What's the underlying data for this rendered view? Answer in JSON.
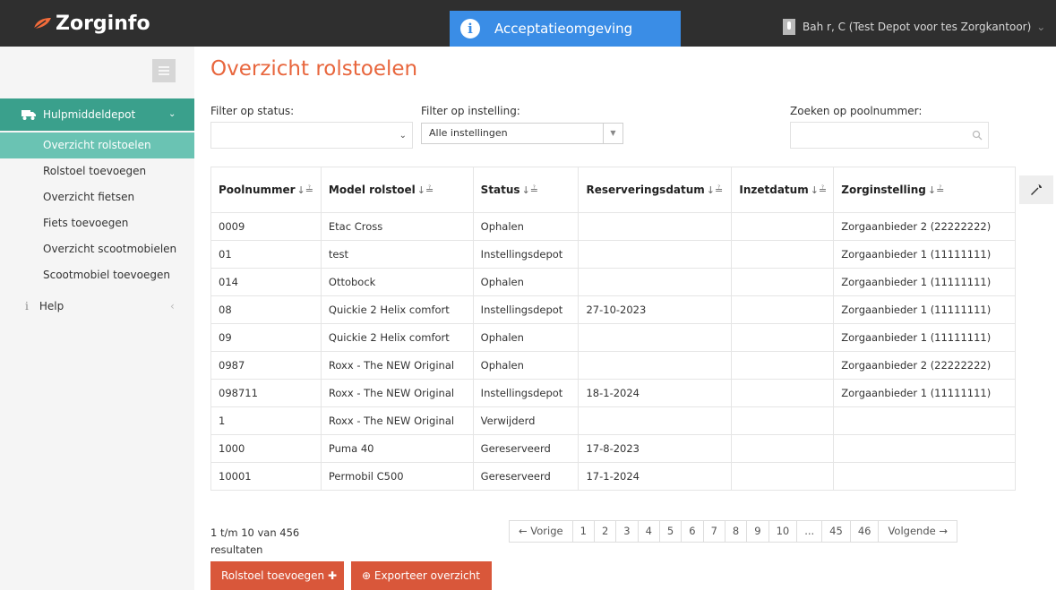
{
  "header": {
    "logo_text": "Zorginfo",
    "environment": "Acceptatieomgeving",
    "environment_icon": "i",
    "user": "Bah r, C (Test Depot voor tes Zorgkantoor)",
    "user_caret": "⌄"
  },
  "colors": {
    "topbar": "#2f2f2f",
    "environment_banner": "#3a8de6",
    "sidebar_section": "#3aa08c",
    "sidebar_active": "#6ac3b3",
    "title": "#e8663d",
    "button": "#d9573a"
  },
  "sidebar": {
    "section_label": "Hulpmiddeldepot",
    "section_icon": "truck-icon",
    "items": [
      {
        "label": "Overzicht rolstoelen",
        "active": true
      },
      {
        "label": "Rolstoel toevoegen"
      },
      {
        "label": "Overzicht fietsen"
      },
      {
        "label": "Fiets toevoegen"
      },
      {
        "label": "Overzicht scootmobielen"
      },
      {
        "label": "Scootmobiel toevoegen"
      }
    ],
    "help_label": "Help"
  },
  "main": {
    "title": "Overzicht rolstoelen",
    "filter_status_label": "Filter op status:",
    "filter_status_value": "",
    "filter_instelling_label": "Filter op instelling:",
    "filter_instelling_value": "Alle instellingen",
    "search_label": "Zoeken op poolnummer:",
    "search_value": ""
  },
  "table": {
    "sort_glyph": "↓≟",
    "columns": [
      "Poolnummer",
      "Model rolstoel",
      "Status",
      "Reserveringsdatum",
      "Inzetdatum",
      "Zorginstelling"
    ],
    "rows": [
      [
        "0009",
        "Etac Cross",
        "Ophalen",
        "",
        "",
        "Zorgaanbieder 2 (22222222)"
      ],
      [
        "01",
        "test",
        "Instellingsdepot",
        "",
        "",
        "Zorgaanbieder 1 (11111111)"
      ],
      [
        "014",
        "Ottobock",
        "Ophalen",
        "",
        "",
        "Zorgaanbieder 1 (11111111)"
      ],
      [
        "08",
        "Quickie 2 Helix comfort",
        "Instellingsdepot",
        "27-10-2023",
        "",
        "Zorgaanbieder 1 (11111111)"
      ],
      [
        "09",
        "Quickie 2 Helix comfort",
        "Ophalen",
        "",
        "",
        "Zorgaanbieder 1 (11111111)"
      ],
      [
        "0987",
        "Roxx - The NEW Original",
        "Ophalen",
        "",
        "",
        "Zorgaanbieder 2 (22222222)"
      ],
      [
        "098711",
        "Roxx - The NEW Original",
        "Instellingsdepot",
        "18-1-2024",
        "",
        "Zorgaanbieder 1 (11111111)"
      ],
      [
        "1",
        "Roxx - The NEW Original",
        "Verwijderd",
        "",
        "",
        ""
      ],
      [
        "1000",
        "Puma 40",
        "Gereserveerd",
        "17-8-2023",
        "",
        ""
      ],
      [
        "10001",
        "Permobil C500",
        "Gereserveerd",
        "17-1-2024",
        "",
        ""
      ]
    ]
  },
  "footer": {
    "results_text": "1 t/m 10 van 456 resultaten",
    "pagination": [
      "← Vorige",
      "1",
      "2",
      "3",
      "4",
      "5",
      "6",
      "7",
      "8",
      "9",
      "10",
      "...",
      "45",
      "46",
      "Volgende →"
    ],
    "add_button": "Rolstoel toevoegen ✚",
    "export_button": "⊕ Exporteer overzicht"
  }
}
